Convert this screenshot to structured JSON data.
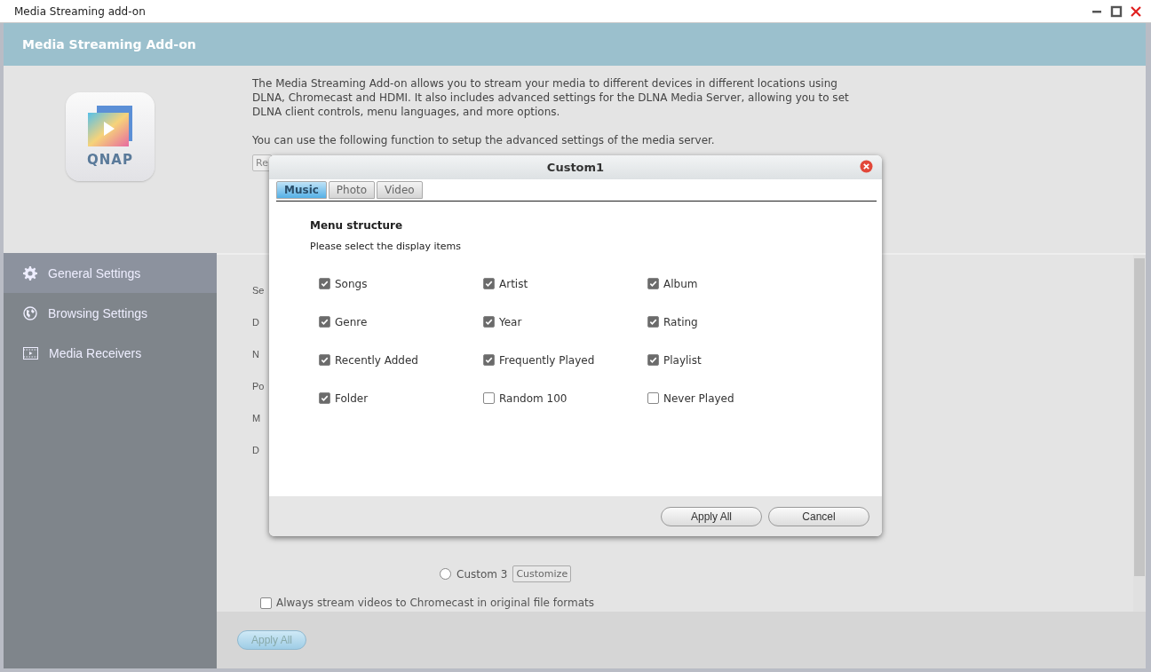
{
  "window": {
    "title": "Media Streaming add-on"
  },
  "app": {
    "title": "Media Streaming Add-on",
    "logo_text": "QNAP"
  },
  "intro": {
    "paragraphs": [
      "The Media Streaming Add-on allows you to stream your media to different devices in different locations using DLNA, Chromecast and HDMI. It also includes advanced settings for the DLNA Media Server, allowing you to set DLNA client controls, menu languages, and more options.",
      "You can use the following function to setup the advanced settings of the media server."
    ],
    "button": "Re"
  },
  "sidebar": {
    "items": [
      {
        "label": "General Settings",
        "kind": "gear",
        "selected": true
      },
      {
        "label": "Browsing Settings",
        "kind": "globe",
        "selected": false
      },
      {
        "label": "Media Receivers",
        "kind": "film",
        "selected": false
      }
    ]
  },
  "settings": {
    "labels": [
      "Se",
      "D",
      "N",
      "Po",
      "M",
      "D"
    ],
    "options": [
      {
        "label": "Custom 3",
        "selected": false,
        "button": "Customize"
      }
    ],
    "chromecast_option": {
      "label": "Always stream videos to Chromecast in original file formats",
      "checked": false
    }
  },
  "footer": {
    "button": "Apply All"
  },
  "dialog": {
    "title": "Custom1",
    "tabs": [
      {
        "label": "Music",
        "selected": true
      },
      {
        "label": "Photo",
        "selected": false
      },
      {
        "label": "Video",
        "selected": false
      }
    ],
    "heading": "Menu structure",
    "instruction": "Please select the display items",
    "items": [
      {
        "label": "Songs",
        "checked": true
      },
      {
        "label": "Artist",
        "checked": true
      },
      {
        "label": "Album",
        "checked": true
      },
      {
        "label": "Genre",
        "checked": true
      },
      {
        "label": "Year",
        "checked": true
      },
      {
        "label": "Rating",
        "checked": true
      },
      {
        "label": "Recently Added",
        "checked": true
      },
      {
        "label": "Frequently Played",
        "checked": true
      },
      {
        "label": "Playlist",
        "checked": true
      },
      {
        "label": "Folder",
        "checked": true
      },
      {
        "label": "Random 100",
        "checked": false
      },
      {
        "label": "Never Played",
        "checked": false
      }
    ],
    "buttons": [
      "Apply All",
      "Cancel"
    ]
  }
}
